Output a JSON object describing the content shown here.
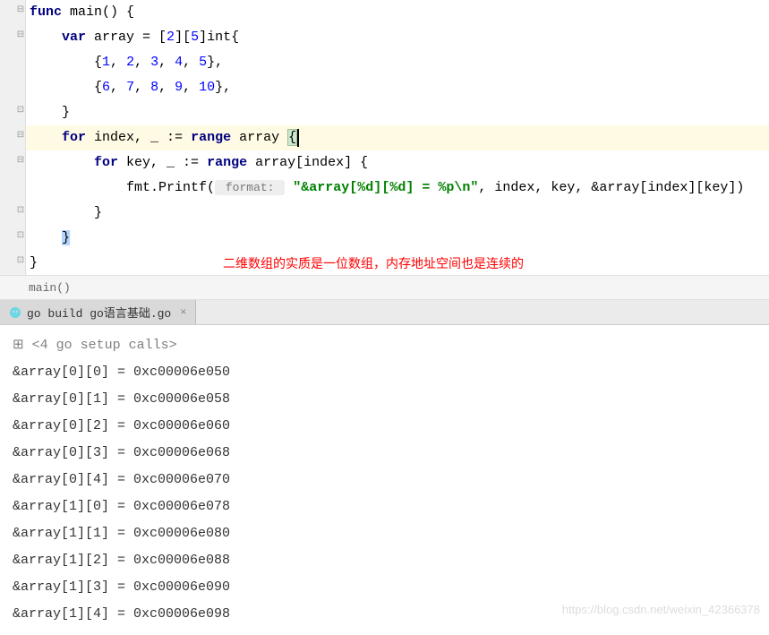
{
  "code": {
    "l1_func": "func",
    "l1_name": " main() {",
    "l2_var": "var",
    "l2_rest": " array = [",
    "l2_n1": "2",
    "l2_mid": "][",
    "l2_n2": "5",
    "l2_end": "]int{",
    "l3_open": "{",
    "l3_nums": [
      "1",
      "2",
      "3",
      "4",
      "5"
    ],
    "l3_close": "},",
    "l4_open": "{",
    "l4_nums": [
      "6",
      "7",
      "8",
      "9",
      "10"
    ],
    "l4_close": "},",
    "l5": "}",
    "l6_for": "for",
    "l6_mid": " index, _ := ",
    "l6_range": "range",
    "l6_end": " array ",
    "l6_brace": "{",
    "l7_for": "for",
    "l7_mid": " key, _ := ",
    "l7_range": "range",
    "l7_end": " array[index] {",
    "l8_fmt": "fmt.Printf(",
    "l8_hint": " format: ",
    "l8_str": "\"&array[%d][%d] = %p\\n\"",
    "l8_rest": ", index, key, &array[index][key])",
    "l9": "}",
    "l10": "}",
    "l11": "}",
    "annotation": "二维数组的实质是一位数组，内存地址空间也是连续的"
  },
  "breadcrumb": "main()",
  "run_tab": "go build go语言基础.go",
  "console": {
    "setup": "<4 go setup calls>",
    "lines": [
      "&array[0][0] = 0xc00006e050",
      "&array[0][1] = 0xc00006e058",
      "&array[0][2] = 0xc00006e060",
      "&array[0][3] = 0xc00006e068",
      "&array[0][4] = 0xc00006e070",
      "&array[1][0] = 0xc00006e078",
      "&array[1][1] = 0xc00006e080",
      "&array[1][2] = 0xc00006e088",
      "&array[1][3] = 0xc00006e090",
      "&array[1][4] = 0xc00006e098"
    ]
  },
  "watermark": "https://blog.csdn.net/weixin_42366378"
}
